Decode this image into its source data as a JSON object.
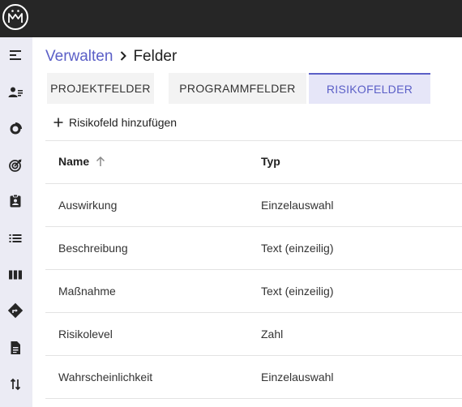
{
  "app": {
    "logo_icon": "mm-logo-icon",
    "topbar_color": "#262626",
    "accent_color": "#5b5fc7"
  },
  "sidebar": {
    "icons": [
      "menu-collapse-icon",
      "user-list-icon",
      "pie-chart-icon",
      "target-icon",
      "badge-icon",
      "list-icon",
      "columns-icon",
      "route-icon",
      "document-icon",
      "sort-arrows-icon"
    ]
  },
  "breadcrumb": {
    "parent": "Verwalten",
    "current": "Felder"
  },
  "tabs": [
    {
      "label": "PROJEKTFELDER",
      "active": false
    },
    {
      "label": "PROGRAMMFELDER",
      "active": false
    },
    {
      "label": "RISIKOFELDER",
      "active": true
    }
  ],
  "toolbar": {
    "add_label": "Risikofeld hinzufügen"
  },
  "table": {
    "columns": [
      "Name",
      "Typ"
    ],
    "sort": {
      "column": "Name",
      "direction": "ascending"
    },
    "rows": [
      {
        "name": "Auswirkung",
        "type": "Einzelauswahl"
      },
      {
        "name": "Beschreibung",
        "type": "Text (einzeilig)"
      },
      {
        "name": "Maßnahme",
        "type": "Text (einzeilig)"
      },
      {
        "name": "Risikolevel",
        "type": "Zahl"
      },
      {
        "name": "Wahrscheinlichkeit",
        "type": "Einzelauswahl"
      }
    ]
  }
}
